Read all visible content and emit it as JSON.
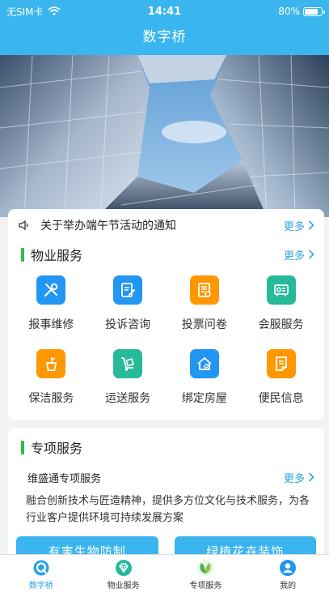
{
  "status_bar": {
    "carrier": "无SIM卡",
    "time": "14:41",
    "battery": "80%",
    "battery_level": 0.8
  },
  "header": {
    "title": "数字桥"
  },
  "notice": {
    "text": "关于举办端午节活动的通知",
    "more_label": "更多"
  },
  "property_service": {
    "title": "物业服务",
    "more_label": "更多",
    "items": [
      {
        "label": "报事维修",
        "icon": "wrench-screwdriver-icon",
        "color": "#2196f3"
      },
      {
        "label": "投诉咨询",
        "icon": "edit-document-icon",
        "color": "#2196f3"
      },
      {
        "label": "投票问卷",
        "icon": "ballot-icon",
        "color": "#ff9800"
      },
      {
        "label": "会服服务",
        "icon": "projector-icon",
        "color": "#26b99a"
      },
      {
        "label": "保洁服务",
        "icon": "broom-bucket-icon",
        "color": "#ff9800"
      },
      {
        "label": "运送服务",
        "icon": "hand-truck-icon",
        "color": "#26b99a"
      },
      {
        "label": "绑定房屋",
        "icon": "house-check-icon",
        "color": "#2196f3"
      },
      {
        "label": "便民信息",
        "icon": "info-note-icon",
        "color": "#ff9800"
      }
    ]
  },
  "special_service": {
    "title": "专项服务",
    "name": "维盛通专项服务",
    "more_label": "更多",
    "description": "融合创新技术与匠造精神，提供多方位文化与技术服务，为各行业客户提供环境可持续发展方案",
    "buttons": [
      "有害生物防制",
      "绿植花卉装饰"
    ]
  },
  "tabbar": {
    "tabs": [
      {
        "label": "数字桥",
        "icon": "digital-bridge-icon",
        "active": true
      },
      {
        "label": "物业服务",
        "icon": "diamond-icon",
        "active": false
      },
      {
        "label": "专项服务",
        "icon": "leaf-icon",
        "active": false
      },
      {
        "label": "我的",
        "icon": "user-icon",
        "active": false
      }
    ]
  },
  "colors": {
    "primary": "#3ab5ee",
    "accent_green": "#2dbd4a",
    "link": "#2aa3e6"
  }
}
